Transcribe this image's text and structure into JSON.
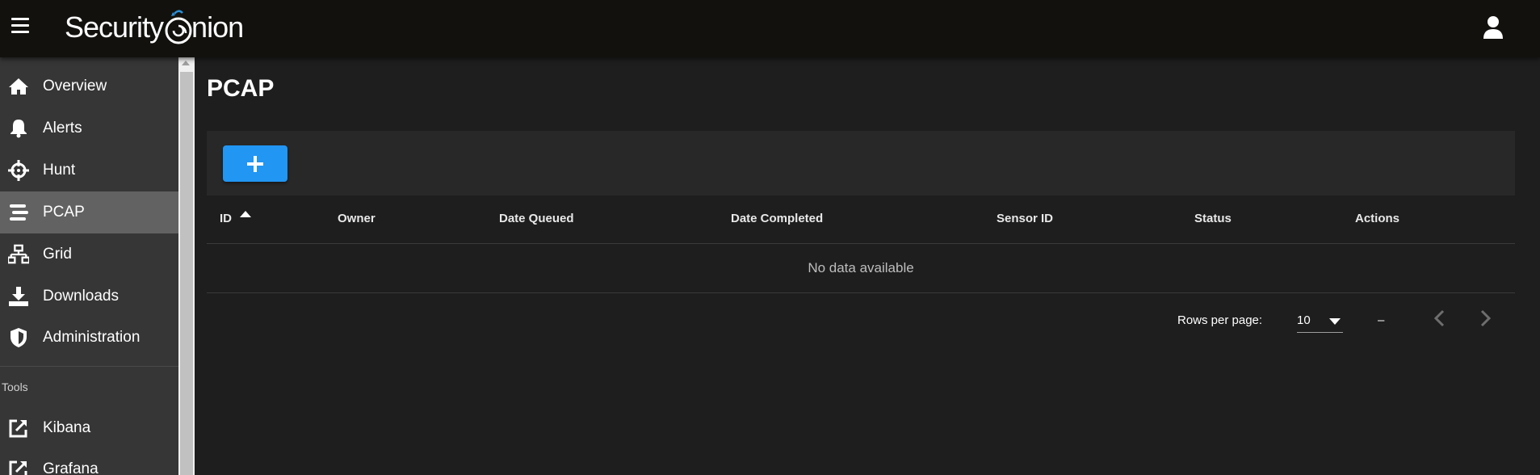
{
  "header": {
    "brand": "Security Onion",
    "brand_part1": "Security",
    "brand_part2": "nion"
  },
  "sidebar": {
    "items": [
      {
        "label": "Overview",
        "icon": "home-icon"
      },
      {
        "label": "Alerts",
        "icon": "bell-icon"
      },
      {
        "label": "Hunt",
        "icon": "crosshairs-icon"
      },
      {
        "label": "PCAP",
        "icon": "stream-icon",
        "active": true
      },
      {
        "label": "Grid",
        "icon": "network-icon"
      },
      {
        "label": "Downloads",
        "icon": "download-icon"
      },
      {
        "label": "Administration",
        "icon": "shield-icon"
      }
    ],
    "tools_header": "Tools",
    "tools": [
      {
        "label": "Kibana",
        "icon": "external-link-icon"
      },
      {
        "label": "Grafana",
        "icon": "external-link-icon"
      }
    ]
  },
  "page": {
    "title": "PCAP"
  },
  "table": {
    "columns": [
      "ID",
      "Owner",
      "Date Queued",
      "Date Completed",
      "Sensor ID",
      "Status",
      "Actions"
    ],
    "sorted_column": "ID",
    "sort_direction": "ascending",
    "empty_text": "No data available"
  },
  "pagination": {
    "rows_per_page_label": "Rows per page:",
    "rows_per_page_value": "10",
    "range_text": "–"
  },
  "colors": {
    "topbar": "#12110e",
    "sidebar": "#363636",
    "sidebar_active": "#626262",
    "main_bg": "#1e1e1e",
    "toolbar_bg": "#282828",
    "accent": "#2196f3",
    "logo_swirl": "#2b8fd6"
  }
}
